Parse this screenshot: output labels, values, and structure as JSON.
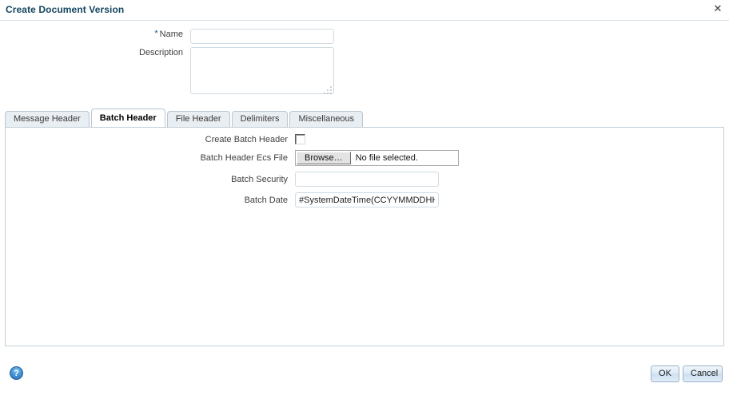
{
  "dialog": {
    "title": "Create Document Version",
    "close_label": "✕"
  },
  "header_form": {
    "name": {
      "label": "Name",
      "required_marker": "*",
      "value": "",
      "placeholder": ""
    },
    "description": {
      "label": "Description",
      "value": "",
      "placeholder": ""
    }
  },
  "tabs": [
    {
      "label": "Message Header",
      "active": false
    },
    {
      "label": "Batch Header",
      "active": true
    },
    {
      "label": "File Header",
      "active": false
    },
    {
      "label": "Delimiters",
      "active": false
    },
    {
      "label": "Miscellaneous",
      "active": false
    }
  ],
  "batch_header_panel": {
    "create_batch_header": {
      "label": "Create Batch Header",
      "checked": false
    },
    "batch_header_ecs_file": {
      "label": "Batch Header Ecs File",
      "button_label": "Browse…",
      "file_status": "No file selected."
    },
    "batch_security": {
      "label": "Batch Security",
      "value": "",
      "placeholder": ""
    },
    "batch_date": {
      "label": "Batch Date",
      "value": "#SystemDateTime(CCYYMMDDHHMM)",
      "placeholder": ""
    }
  },
  "footer": {
    "help_label": "?",
    "ok_label": "OK",
    "cancel_label": "Cancel"
  },
  "colors": {
    "title_text": "#12455e",
    "required_star": "#17618e",
    "panel_border": "#c3ced8",
    "tab_inactive_bg": "#e9eef2",
    "tab_active_bg": "#ffffff",
    "help_icon_blue": "#3f8fd4",
    "button_border": "#9ab2c8"
  }
}
